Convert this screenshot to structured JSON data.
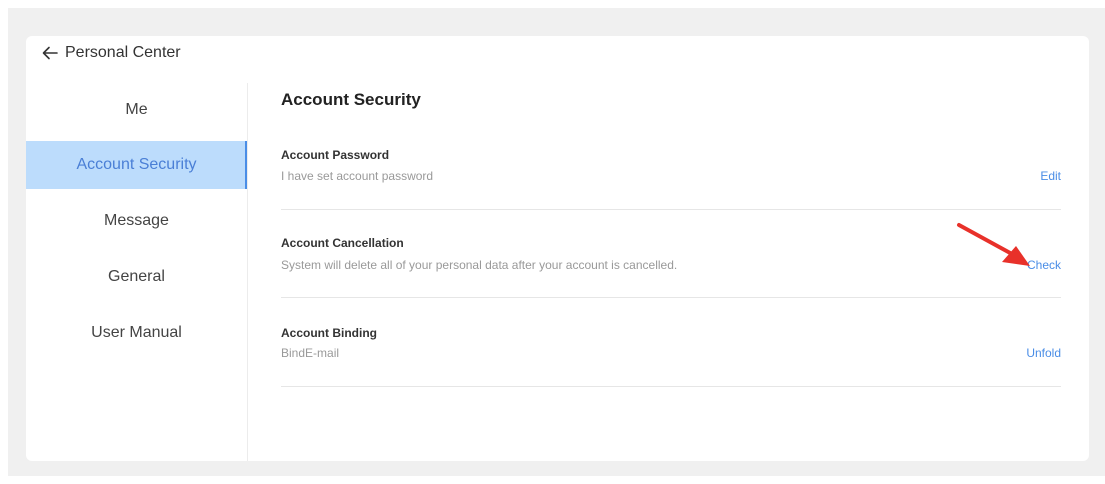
{
  "header": {
    "back_label": "Personal Center"
  },
  "sidebar": {
    "items": [
      {
        "label": "Me"
      },
      {
        "label": "Account Security"
      },
      {
        "label": "Message"
      },
      {
        "label": "General"
      },
      {
        "label": "User Manual"
      }
    ],
    "active_item": "Account Security"
  },
  "main": {
    "section_title": "Account Security",
    "rows": [
      {
        "title": "Account Password",
        "description": "I have set account password",
        "action": "Edit"
      },
      {
        "title": "Account Cancellation",
        "description": "System will delete all of your personal data after your account is cancelled.",
        "action": "Check"
      },
      {
        "title": "Account Binding",
        "description": "BindE-mail",
        "action": "Unfold"
      }
    ]
  },
  "colors": {
    "accent": "#4a8de6",
    "active_bg": "#bcdcfc",
    "annotation_arrow": "#e8312a"
  },
  "icons": {
    "back": "arrow-left-icon",
    "annotation": "red-arrow-annotation"
  }
}
